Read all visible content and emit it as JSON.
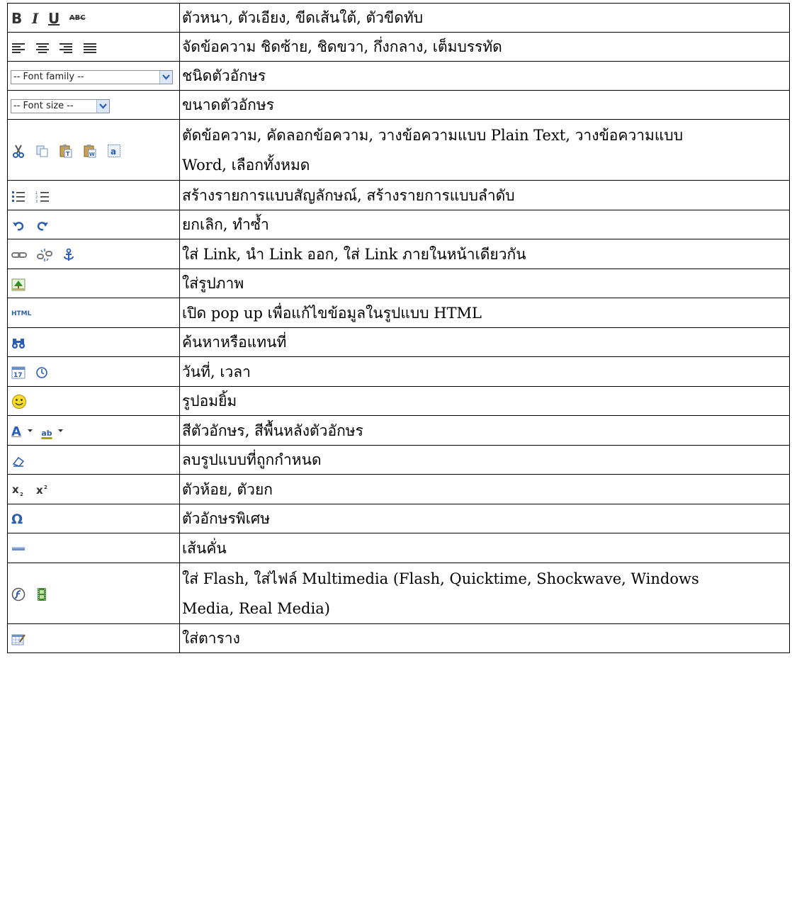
{
  "rows": [
    {
      "text": "ตัวหนา, ตัวเอียง, ขีดเส้นใต้, ตัวขีดทับ",
      "icons": [
        "bold-icon",
        "italic-icon",
        "underline-icon",
        "strikethrough-icon"
      ],
      "icon_text": [
        "B",
        "I",
        "U",
        "ABC"
      ]
    },
    {
      "text": "จัดข้อความ ชิดซ้าย, ชิดขวา, กึ่งกลาง, เต็มบรรทัด",
      "icons": [
        "align-left-icon",
        "align-center-icon",
        "align-right-icon",
        "align-justify-icon"
      ]
    },
    {
      "text": "ชนิดตัวอักษร",
      "select_label": "-- Font family --"
    },
    {
      "text": "ขนาดตัวอักษร",
      "select_label": "-- Font size --"
    },
    {
      "text_lines": [
        "ตัดข้อความ, คัดลอกข้อความ, วางข้อความแบบ Plain Text, วางข้อความแบบ",
        "Word, เลือกทั้งหมด"
      ],
      "icons": [
        "cut-icon",
        "copy-icon",
        "paste-text-icon",
        "paste-word-icon",
        "select-all-icon"
      ]
    },
    {
      "text": "สร้างรายการแบบสัญลักษณ์, สร้างรายการแบบลำดับ",
      "icons": [
        "bullet-list-icon",
        "numbered-list-icon"
      ]
    },
    {
      "text": "ยกเลิก, ทำซ้ำ",
      "icons": [
        "undo-icon",
        "redo-icon"
      ]
    },
    {
      "text": "ใส่ Link, นำ Link ออก, ใส่ Link ภายในหน้าเดียวกัน",
      "icons": [
        "link-icon",
        "unlink-icon",
        "anchor-icon"
      ]
    },
    {
      "text": "ใส่รูปภาพ",
      "icons": [
        "image-icon"
      ]
    },
    {
      "text": "เปิด pop up เพื่อแก้ไขข้อมูลในรูปแบบ HTML",
      "icons": [
        "html-icon"
      ],
      "icon_text": [
        "HTML"
      ]
    },
    {
      "text": "ค้นหาหรือแทนที่",
      "icons": [
        "binoculars-icon"
      ]
    },
    {
      "text": "วันที่, เวลา",
      "icons": [
        "calendar-icon",
        "clock-icon"
      ]
    },
    {
      "text": "รูปอมยิ้ม",
      "icons": [
        "smiley-icon"
      ]
    },
    {
      "text": "สีตัวอักษร, สีพื้นหลังตัวอักษร",
      "icons": [
        "font-color-icon",
        "highlight-color-icon"
      ],
      "icon_text": [
        "A",
        "ab"
      ]
    },
    {
      "text": "ลบรูปแบบที่ถูกกำหนด",
      "icons": [
        "eraser-icon"
      ]
    },
    {
      "text": "ตัวห้อย, ตัวยก",
      "icons": [
        "subscript-icon",
        "superscript-icon"
      ]
    },
    {
      "text": "ตัวอักษรพิเศษ",
      "icons": [
        "omega-icon"
      ],
      "icon_text": [
        "Ω"
      ]
    },
    {
      "text": "เส้นคั่น",
      "icons": [
        "horizontal-rule-icon"
      ]
    },
    {
      "text_lines": [
        "ใส่ Flash, ใส่ไฟล์ Multimedia (Flash, Quicktime, Shockwave, Windows",
        "Media, Real Media)"
      ],
      "icons": [
        "flash-icon",
        "media-icon"
      ]
    },
    {
      "text": "ใส่ตาราง",
      "icons": [
        "table-icon"
      ]
    }
  ],
  "colors": {
    "icon_dark": "#333333",
    "icon_blue": "#2b5db5",
    "select_border": "#8d8d8d",
    "select_arrow_bg": "#dbe7fb"
  }
}
